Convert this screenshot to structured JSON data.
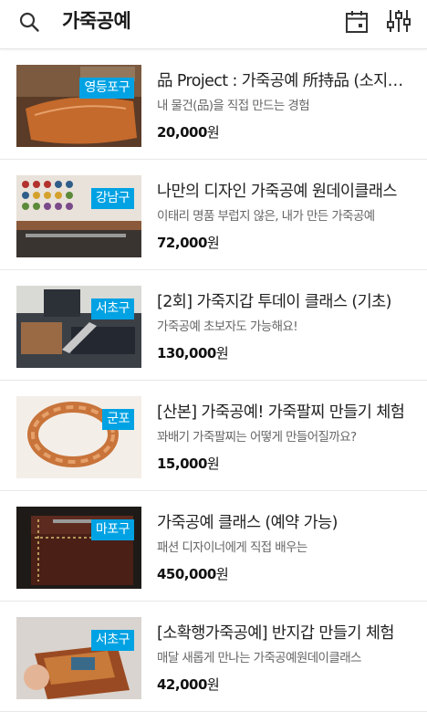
{
  "header": {
    "query": "가죽공예",
    "icons": [
      "search-icon",
      "calendar-icon",
      "filter-icon"
    ]
  },
  "colors": {
    "badge": "#00a2e3",
    "divider": "#e8e8e8"
  },
  "items": [
    {
      "title": "品 Project : 가죽공예 所持品 (소지품) 공방",
      "subtitle": "내 물건(品)을 직접 만드는 경험",
      "price": "20,000",
      "unit": "원",
      "location": "영등포구"
    },
    {
      "title": "나만의 디자인 가죽공예 원데이클래스",
      "subtitle": "이태리 명품 부럽지 않은, 내가 만든 가죽공예",
      "price": "72,000",
      "unit": "원",
      "location": "강남구"
    },
    {
      "title": "[2회] 가죽지갑 투데이 클래스 (기초)",
      "subtitle": "가죽공예 초보자도 가능해요!",
      "price": "130,000",
      "unit": "원",
      "location": "서초구"
    },
    {
      "title": "[산본] 가죽공예! 가죽팔찌 만들기 체험",
      "subtitle": "꽈배기 가죽팔찌는 어떻게 만들어질까요?",
      "price": "15,000",
      "unit": "원",
      "location": "군포"
    },
    {
      "title": "가죽공예 클래스 (예약 가능)",
      "subtitle": "패션 디자이너에게 직접 배우는",
      "price": "450,000",
      "unit": "원",
      "location": "마포구"
    },
    {
      "title": "[소확행가죽공예] 반지갑 만들기 체험",
      "subtitle": "매달 새롭게 만나는 가죽공예원데이클래스",
      "price": "42,000",
      "unit": "원",
      "location": "서초구"
    }
  ]
}
